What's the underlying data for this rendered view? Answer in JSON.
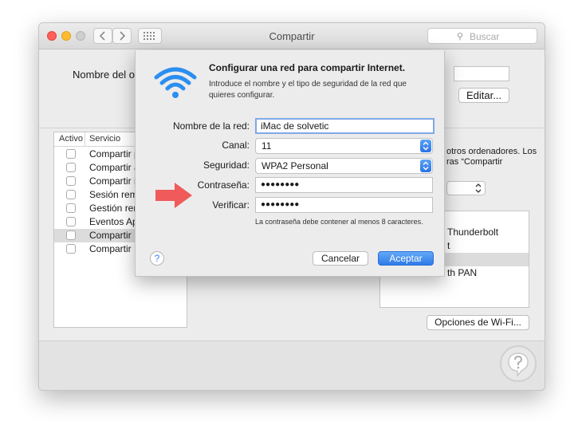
{
  "window": {
    "title": "Compartir",
    "search_placeholder": "Buscar",
    "computer_name_label": "Nombre del ord",
    "edit_button": "Editar..."
  },
  "services": {
    "col_active": "Activo",
    "col_service": "Servicio",
    "items": [
      {
        "label": "Compartir p"
      },
      {
        "label": "Compartir a"
      },
      {
        "label": "Compartir ir"
      },
      {
        "label": "Sesión remo"
      },
      {
        "label": "Gestión rem"
      },
      {
        "label": "Eventos App"
      },
      {
        "label": "Compartir In"
      },
      {
        "label": "Compartir B"
      }
    ]
  },
  "right_panel": {
    "text_line1": "otros ordenadores. Los",
    "text_line2": "ras “Compartir",
    "interfaces": [
      {
        "label": "Thunderbolt"
      },
      {
        "label": "t"
      },
      {
        "label": ""
      },
      {
        "label": "th PAN"
      }
    ],
    "wifi_options_button": "Opciones de Wi-Fi..."
  },
  "sheet": {
    "title": "Configurar una red para compartir Internet.",
    "description": "Introduce el nombre y el tipo de seguridad de la red que quieres configurar.",
    "fields": {
      "network_name": {
        "label": "Nombre de la red:",
        "value": "iMac de solvetic"
      },
      "channel": {
        "label": "Canal:",
        "value": "11"
      },
      "security": {
        "label": "Seguridad:",
        "value": "WPA2 Personal"
      },
      "password": {
        "label": "Contraseña:",
        "value": "●●●●●●●●"
      },
      "verify": {
        "label": "Verificar:",
        "value": "●●●●●●●●"
      }
    },
    "hint": "La contraseña debe contener al menos 8 caracteres.",
    "help_label": "?",
    "cancel_button": "Cancelar",
    "accept_button": "Aceptar"
  },
  "colors": {
    "accent": "#2f7ae8",
    "wifi_icon": "#2b8ef0",
    "arrow": "#f05a5a"
  },
  "icons": {
    "wifi": "wifi-icon",
    "arrow": "red-arrow-icon",
    "search": "search-icon"
  }
}
